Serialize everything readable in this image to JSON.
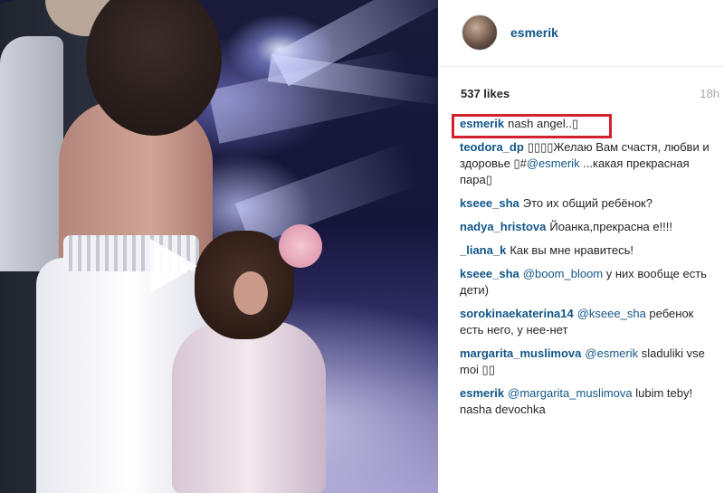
{
  "post": {
    "username": "esmerik",
    "likes": "537 likes",
    "time": "18h"
  },
  "media": {
    "type": "video",
    "play_icon": "play-icon"
  },
  "comments": [
    {
      "author": "esmerik",
      "parts": [
        {
          "text": "nash angel..▯"
        }
      ]
    },
    {
      "author": "teodora_dp",
      "parts": [
        {
          "text": "▯▯▯▯Желаю Вам счастя, любви и здоровье ▯#"
        },
        {
          "text": "@esmerik",
          "mention": true
        },
        {
          "text": " ...какая прекрасная пара▯"
        }
      ]
    },
    {
      "author": "kseee_sha",
      "parts": [
        {
          "text": "Это их общий ребёнок?"
        }
      ]
    },
    {
      "author": "nadya_hristova",
      "parts": [
        {
          "text": "Йоанка,прекрасна е!!!!"
        }
      ]
    },
    {
      "author": "_liana_k",
      "parts": [
        {
          "text": "Как вы мне нравитесь!"
        }
      ]
    },
    {
      "author": "kseee_sha",
      "parts": [
        {
          "text": "@boom_bloom",
          "mention": true
        },
        {
          "text": " у них вообще есть дети)"
        }
      ]
    },
    {
      "author": "sorokinaekaterina14",
      "parts": [
        {
          "text": "@kseee_sha",
          "mention": true
        },
        {
          "text": " ребенок есть него, у нее-нет"
        }
      ]
    },
    {
      "author": "margarita_muslimova",
      "parts": [
        {
          "text": "@esmerik",
          "mention": true
        },
        {
          "text": " sladuliki vse moi ▯▯"
        }
      ]
    },
    {
      "author": "esmerik",
      "parts": [
        {
          "text": "@margarita_muslimova",
          "mention": true
        },
        {
          "text": " lubim teby! nasha devochka"
        }
      ]
    }
  ],
  "colors": {
    "link": "#125688",
    "highlight_border": "#d3222e",
    "muted": "#a5a7aa"
  }
}
